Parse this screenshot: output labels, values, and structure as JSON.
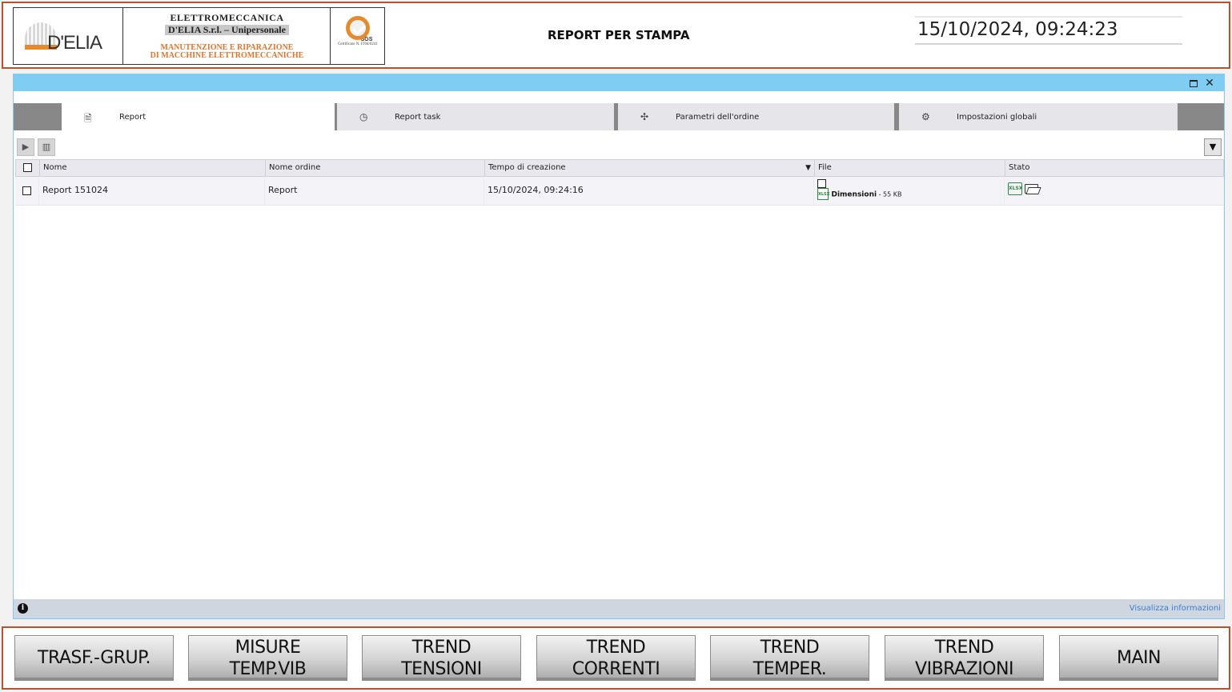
{
  "header": {
    "logo": {
      "brand": "D'ELIA",
      "line1": "ELETTROMECCANICA",
      "line2": "D'ELIA S.r.l. – Unipersonale",
      "line3": "MANUTENZIONE E RIPARAZIONE",
      "line4": "DI MACCHINE ELETTROMECCANICHE",
      "cert_brand": "SGS",
      "cert_text": "Certificato N. IT04/0241"
    },
    "title": "REPORT PER STAMPA",
    "datetime": "15/10/2024, 09:24:23"
  },
  "window": {
    "tabs": [
      {
        "label": "Report",
        "icon": "report-icon",
        "active": true
      },
      {
        "label": "Report task",
        "icon": "clock-icon",
        "active": false
      },
      {
        "label": "Parametri dell'ordine",
        "icon": "puzzle-icon",
        "active": false
      },
      {
        "label": "Impostazioni globali",
        "icon": "gear-icon",
        "active": false
      }
    ],
    "toolbar": {
      "export_icon": "export-report-icon",
      "delete_icon": "trash-icon",
      "filter_icon": "filter-icon"
    },
    "table": {
      "columns": [
        "Nome",
        "Nome ordine",
        "Tempo di creazione",
        "File",
        "Stato"
      ],
      "sort_column": "Tempo di creazione",
      "sort_direction": "descending",
      "rows": [
        {
          "nome": "Report 151024",
          "nome_ordine": "Report",
          "tempo": "15/10/2024, 09:24:16",
          "file_name": "Dimensioni",
          "file_size": " - 55 KB",
          "file_type": "XLSX"
        }
      ]
    },
    "status": {
      "link": "Visualizza informazioni"
    }
  },
  "nav": [
    {
      "label": "TRASF.-GRUP."
    },
    {
      "label": "MISURE\nTEMP.VIB"
    },
    {
      "label": "TREND\nTENSIONI"
    },
    {
      "label": "TREND\nCORRENTI"
    },
    {
      "label": "TREND\nTEMPER."
    },
    {
      "label": "TREND\nVIBRAZIONI"
    },
    {
      "label": "MAIN"
    }
  ],
  "colors": {
    "accent_border": "#b3542a",
    "titlebar": "#7fcdf3",
    "logo_orange": "#e0742b",
    "excel_green": "#2b8a3e"
  }
}
